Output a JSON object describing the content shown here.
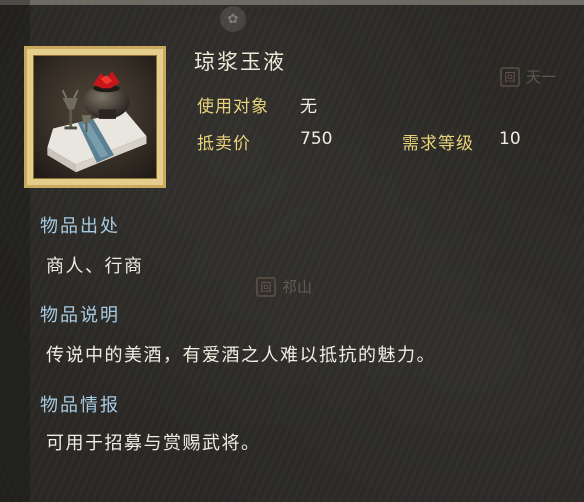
{
  "item": {
    "name": "琼浆玉液",
    "icon": "wine-vessel-icon"
  },
  "stats": {
    "target_label": "使用对象",
    "target_value": "无",
    "price_label": "抵卖价",
    "price_value": "750",
    "level_label": "需求等级",
    "level_value": "10"
  },
  "sections": [
    {
      "title": "物品出处",
      "body": "商人、行商"
    },
    {
      "title": "物品说明",
      "body": "传说中的美酒，有爱酒之人难以抵抗的魅力。"
    },
    {
      "title": "物品情报",
      "body": "可用于招募与赏赐武将。"
    }
  ],
  "map_labels": {
    "top_right": "天一",
    "middle": "祁山",
    "top_seal": "回",
    "mid_seal": "回"
  },
  "colors": {
    "frame_gold": "#c9a95d",
    "label_yellow": "#e8d27a",
    "section_blue": "#a9cbe2",
    "text_white": "#f1ece0"
  }
}
